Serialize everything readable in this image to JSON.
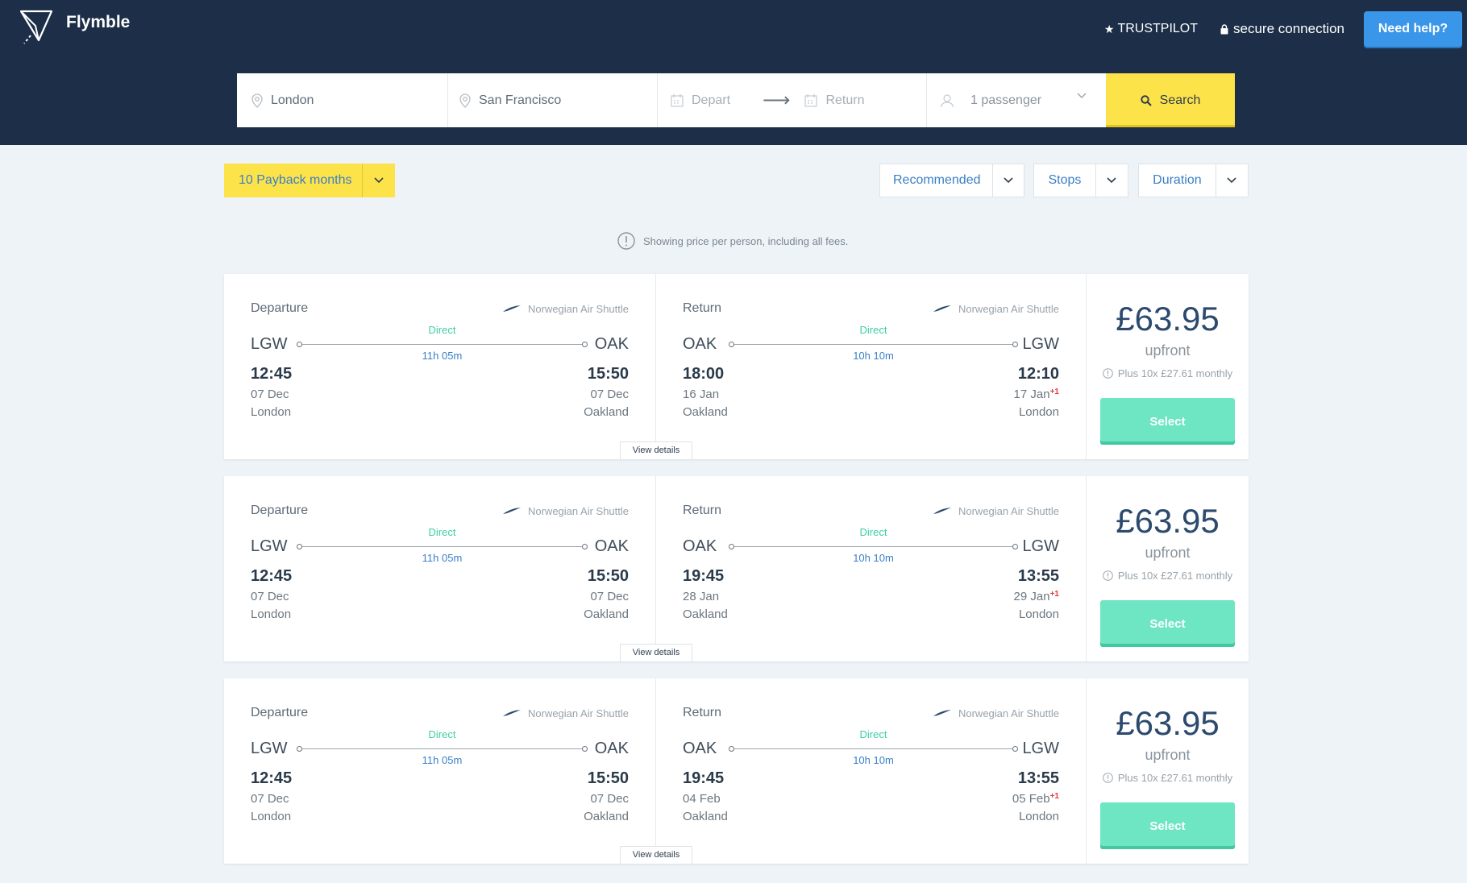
{
  "header": {
    "brand": "Flymble",
    "trustpilot": "TRUSTPILOT",
    "secure": "secure connection",
    "help_label": "Need help?"
  },
  "search": {
    "from": "London",
    "to": "San Francisco",
    "depart_placeholder": "Depart",
    "return_placeholder": "Return",
    "passengers": "1 passenger",
    "button_label": "Search"
  },
  "filters": {
    "payback": "10 Payback months",
    "sort": "Recommended",
    "stops": "Stops",
    "duration": "Duration"
  },
  "notice": "Showing price per person, including all fees.",
  "colors": {
    "header_bg": "#1c2e48",
    "accent_yellow": "#fde34a",
    "select_green": "#6ee5c3",
    "link_blue": "#3a7fc6",
    "direct_green": "#3ccfa5",
    "help_blue": "#3a96e8"
  },
  "results": [
    {
      "out": {
        "title": "Departure",
        "airline": "Norwegian Air Shuttle",
        "from": "LGW",
        "to": "OAK",
        "stops": "Direct",
        "duration": "11h 05m",
        "dep_time": "12:45",
        "arr_time": "15:50",
        "dep_date": "07 Dec",
        "arr_date": "07 Dec",
        "arr_plus": "",
        "dep_city": "London",
        "arr_city": "Oakland"
      },
      "ret": {
        "title": "Return",
        "airline": "Norwegian Air Shuttle",
        "from": "OAK",
        "to": "LGW",
        "stops": "Direct",
        "duration": "10h 10m",
        "dep_time": "18:00",
        "arr_time": "12:10",
        "dep_date": "16 Jan",
        "arr_date": "17 Jan",
        "arr_plus": "+1",
        "dep_city": "Oakland",
        "arr_city": "London"
      },
      "price": "£63.95",
      "upfront": "upfront",
      "monthly": "Plus 10x £27.61 monthly",
      "select": "Select",
      "view_details": "View details"
    },
    {
      "out": {
        "title": "Departure",
        "airline": "Norwegian Air Shuttle",
        "from": "LGW",
        "to": "OAK",
        "stops": "Direct",
        "duration": "11h 05m",
        "dep_time": "12:45",
        "arr_time": "15:50",
        "dep_date": "07 Dec",
        "arr_date": "07 Dec",
        "arr_plus": "",
        "dep_city": "London",
        "arr_city": "Oakland"
      },
      "ret": {
        "title": "Return",
        "airline": "Norwegian Air Shuttle",
        "from": "OAK",
        "to": "LGW",
        "stops": "Direct",
        "duration": "10h 10m",
        "dep_time": "19:45",
        "arr_time": "13:55",
        "dep_date": "28 Jan",
        "arr_date": "29 Jan",
        "arr_plus": "+1",
        "dep_city": "Oakland",
        "arr_city": "London"
      },
      "price": "£63.95",
      "upfront": "upfront",
      "monthly": "Plus 10x £27.61 monthly",
      "select": "Select",
      "view_details": "View details"
    },
    {
      "out": {
        "title": "Departure",
        "airline": "Norwegian Air Shuttle",
        "from": "LGW",
        "to": "OAK",
        "stops": "Direct",
        "duration": "11h 05m",
        "dep_time": "12:45",
        "arr_time": "15:50",
        "dep_date": "07 Dec",
        "arr_date": "07 Dec",
        "arr_plus": "",
        "dep_city": "London",
        "arr_city": "Oakland"
      },
      "ret": {
        "title": "Return",
        "airline": "Norwegian Air Shuttle",
        "from": "OAK",
        "to": "LGW",
        "stops": "Direct",
        "duration": "10h 10m",
        "dep_time": "19:45",
        "arr_time": "13:55",
        "dep_date": "04 Feb",
        "arr_date": "05 Feb",
        "arr_plus": "+1",
        "dep_city": "Oakland",
        "arr_city": "London"
      },
      "price": "£63.95",
      "upfront": "upfront",
      "monthly": "Plus 10x £27.61 monthly",
      "select": "Select",
      "view_details": "View details"
    }
  ]
}
